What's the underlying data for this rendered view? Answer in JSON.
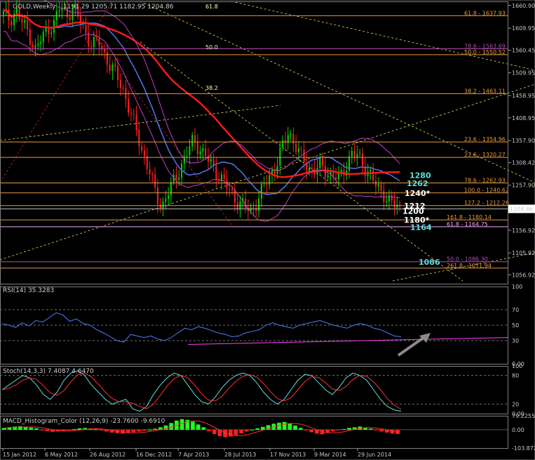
{
  "colors": {
    "background": "#000000",
    "grid": "#6e6e6e",
    "bull": "#00d800",
    "bear": "#ff2020",
    "ma_red": "#ff1a1a",
    "ma_blue": "#4f6fe0",
    "bands": "#c03fc0",
    "fib": "#e89a3a",
    "fib_purple": "#b050b0",
    "fib_light": "#f0a0ff",
    "target_cyan": "#5fdcdc",
    "target_white": "#ffffff",
    "rsi": "#4a7fff",
    "trend": "#ff40ff",
    "arrow": "#8a8a8a",
    "macd_pos": "#20ff20",
    "macd_neg": "#ff2020"
  },
  "header": {
    "symbol_label": "GOLD,Weekly",
    "ohlc_label": "1191.29 1205.71 1182.95 1204.86"
  },
  "chart_data": [
    {
      "type": "candlestick",
      "name": "price",
      "title": "GOLD,Weekly",
      "y_ticks": [
        "1660.90",
        "1609.95",
        "1560.45",
        "1509.95",
        "1458.95",
        "1408.95",
        "1357.90",
        "1308.42",
        "1257.90",
        "1204.86",
        "1156.92",
        "1105.92",
        "1056.92"
      ],
      "ylim": [
        1037,
        1670
      ],
      "current_price": "1204.86",
      "x_ticks": [
        "15 Jan 2012",
        "6 May 2012",
        "26 Aug 2012",
        "16 Dec 2012",
        "7 Apr 2013",
        "28 Jul 2013",
        "17 Nov 2013",
        "9 Mar 2014",
        "29 Jun 2014"
      ],
      "path_points": [
        1640,
        1630,
        1650,
        1620,
        1600,
        1560,
        1585,
        1610,
        1620,
        1660,
        1640,
        1655,
        1630,
        1600,
        1570,
        1580,
        1550,
        1520,
        1500,
        1470,
        1420,
        1380,
        1330,
        1290,
        1240,
        1210,
        1240,
        1270,
        1300,
        1330,
        1360,
        1340,
        1320,
        1300,
        1280,
        1260,
        1240,
        1220,
        1210,
        1200,
        1220,
        1250,
        1280,
        1300,
        1340,
        1380,
        1350,
        1320,
        1300,
        1290,
        1300,
        1290,
        1280,
        1270,
        1300,
        1330,
        1320,
        1300,
        1280,
        1250,
        1240,
        1220,
        1210,
        1200
      ],
      "fib_levels": [
        {
          "label": "61.8 - 1637.93",
          "value": 1637.93,
          "color": "#e89a3a"
        },
        {
          "label": "78.6 - 1563.69",
          "value": 1563.69,
          "color": "#b050b0"
        },
        {
          "label": "50.0 - 1550.52",
          "value": 1550.52,
          "color": "#e89a3a"
        },
        {
          "label": "38.2 - 1463.11",
          "value": 1463.11,
          "color": "#e89a3a"
        },
        {
          "label": "23.6 - 1354.96",
          "value": 1354.96,
          "color": "#e89a3a"
        },
        {
          "label": "23.6 - 1320.27",
          "value": 1320.27,
          "color": "#e89a3a"
        },
        {
          "label": "78.6 - 1262.93",
          "value": 1262.93,
          "color": "#e89a3a"
        },
        {
          "label": "100.0 - 1240.62",
          "value": 1240.62,
          "color": "#e89a3a"
        },
        {
          "label": "127.2 - 1212.26",
          "value": 1212.26,
          "color": "#e89a3a"
        },
        {
          "label": "161.8 - 1180.14",
          "value": 1180.14,
          "color": "#e89a3a"
        },
        {
          "label": "61.8 - 1164.75",
          "value": 1164.75,
          "color": "#f0a0ff"
        },
        {
          "label": "50.0 - 1086.30",
          "value": 1086.3,
          "color": "#b050b0"
        },
        {
          "label": "261.8 - 1071.94",
          "value": 1071.94,
          "color": "#e89a3a"
        }
      ],
      "fan_labels": [
        "61.8",
        "50.0",
        "38.2"
      ],
      "targets": [
        {
          "label": "1280",
          "value": 1280,
          "color": "#5fdcdc"
        },
        {
          "label": "1262",
          "value": 1262,
          "color": "#5fdcdc"
        },
        {
          "label": "1240*",
          "value": 1240,
          "color": "#ffffff"
        },
        {
          "label": "1212",
          "value": 1212,
          "color": "#ffffff"
        },
        {
          "label": "1200",
          "value": 1200,
          "color": "#ffffff"
        },
        {
          "label": "1180*",
          "value": 1180,
          "color": "#ffffff"
        },
        {
          "label": "1164",
          "value": 1164,
          "color": "#5fdcdc"
        },
        {
          "label": "1086",
          "value": 1086,
          "color": "#5fdcdc"
        }
      ]
    },
    {
      "type": "line",
      "name": "rsi",
      "title": "RSI(14) 35.3283",
      "y_ticks": [
        "100",
        "70",
        "50",
        "30",
        "0.00"
      ],
      "ylim": [
        0,
        100
      ],
      "levels": [
        70,
        50,
        30
      ],
      "values": [
        52,
        50,
        47,
        53,
        49,
        56,
        54,
        60,
        66,
        63,
        55,
        58,
        52,
        50,
        44,
        40,
        35,
        30,
        28,
        38,
        36,
        34,
        36,
        32,
        30,
        34,
        40,
        46,
        44,
        48,
        46,
        43,
        40,
        38,
        35,
        36,
        40,
        42,
        44,
        50,
        53,
        50,
        48,
        46,
        50,
        52,
        54,
        56,
        53,
        50,
        48,
        46,
        50,
        52,
        50,
        46,
        44,
        40,
        36,
        35
      ]
    },
    {
      "type": "line",
      "name": "stochastic",
      "title": "Stoch(14,3,3) 7.4087 4.6470",
      "y_ticks": [
        "100",
        "80",
        "20",
        "0.00"
      ],
      "ylim": [
        0,
        100
      ],
      "levels": [
        80,
        20
      ],
      "values": [
        50,
        60,
        70,
        80,
        75,
        60,
        40,
        30,
        45,
        70,
        85,
        90,
        80,
        60,
        45,
        30,
        20,
        25,
        30,
        10,
        5,
        15,
        40,
        60,
        75,
        85,
        80,
        60,
        40,
        25,
        20,
        35,
        55,
        70,
        80,
        85,
        80,
        65,
        45,
        30,
        20,
        30,
        50,
        70,
        82,
        80,
        65,
        50,
        40,
        55,
        75,
        85,
        80,
        70,
        50,
        30,
        15,
        8,
        5
      ]
    },
    {
      "type": "bar",
      "name": "macd",
      "title": "MACD_Histogram_Color (12,26,9) -23.7600 -9.6910",
      "y_ticks": [
        "79.2255",
        "0.00",
        "-103.8729"
      ],
      "ylim": [
        -103.8729,
        79.2255
      ],
      "values": [
        10,
        14,
        18,
        20,
        16,
        12,
        8,
        -4,
        -8,
        -12,
        -10,
        -6,
        -2,
        4,
        8,
        10,
        6,
        2,
        -4,
        -10,
        -16,
        -20,
        -22,
        -18,
        -14,
        -10,
        -6,
        0,
        6,
        14,
        24,
        38,
        52,
        60,
        56,
        46,
        30,
        14,
        -8,
        -24,
        -36,
        -42,
        -38,
        -30,
        -20,
        -10,
        0,
        8,
        16,
        26,
        34,
        40,
        44,
        36,
        24,
        10,
        -4,
        -14,
        -22,
        -26,
        -18,
        -10,
        -4,
        4,
        10,
        14,
        18,
        12,
        6,
        -4,
        -10,
        -16,
        -22,
        -24
      ]
    }
  ]
}
